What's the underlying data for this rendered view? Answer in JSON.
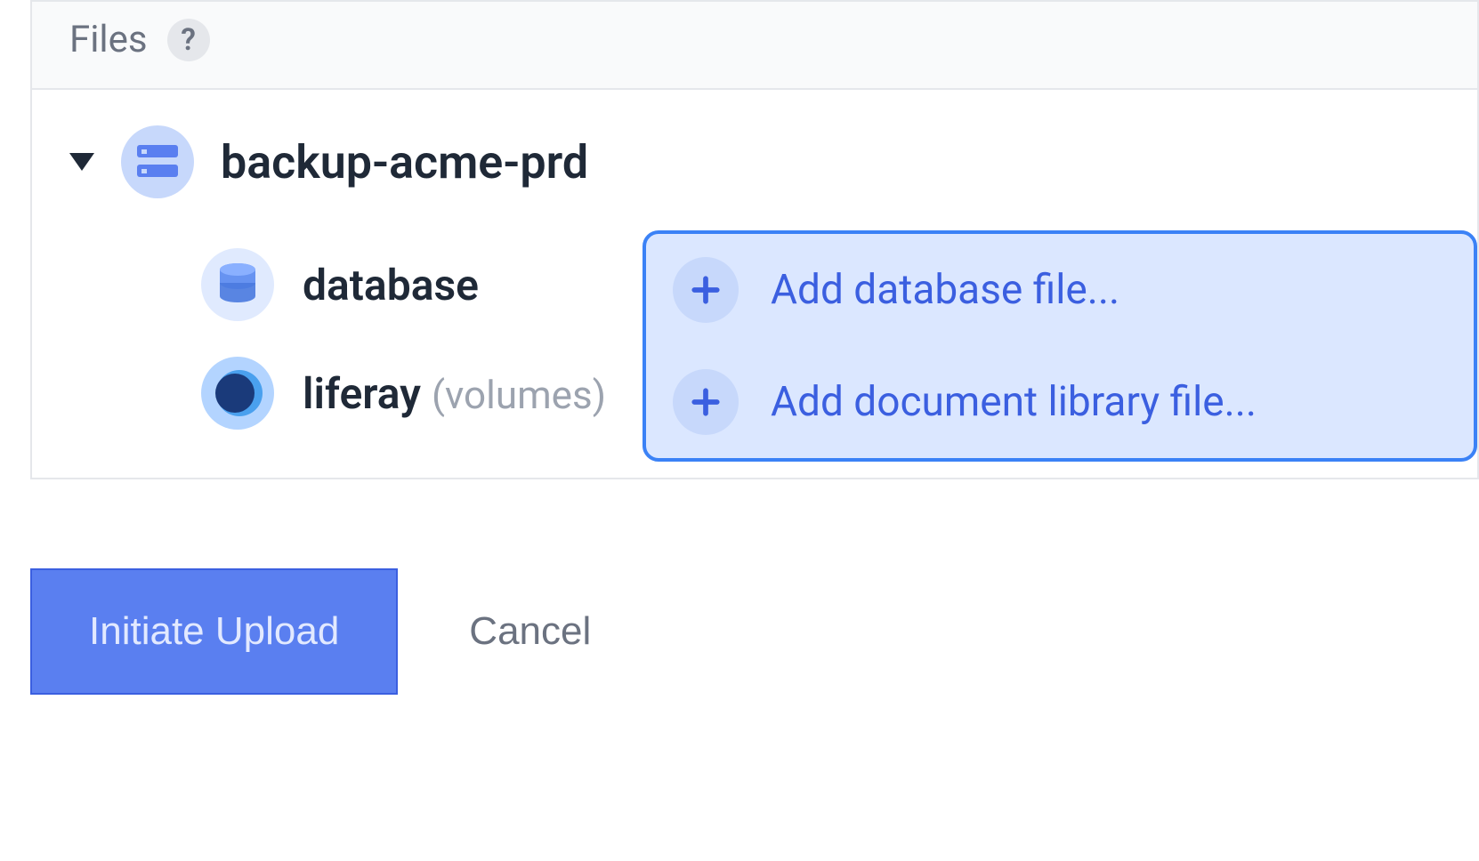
{
  "panel": {
    "title": "Files",
    "help_symbol": "?"
  },
  "tree": {
    "root": {
      "label": "backup-acme-prd"
    },
    "children": [
      {
        "label": "database",
        "sublabel": "",
        "action_label": "Add database file..."
      },
      {
        "label": "liferay",
        "sublabel": "(volumes)",
        "action_label": "Add document library file..."
      }
    ]
  },
  "buttons": {
    "primary": "Initiate Upload",
    "cancel": "Cancel"
  }
}
